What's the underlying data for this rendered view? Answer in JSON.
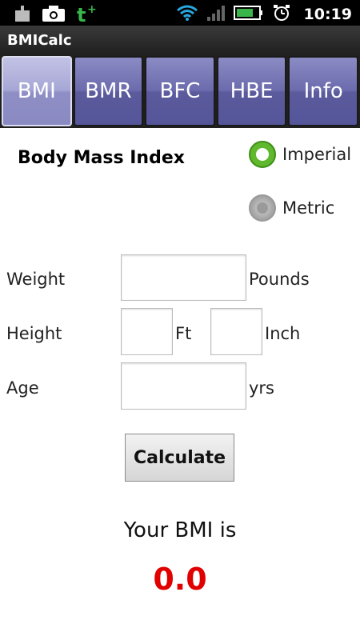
{
  "status_bar": {
    "time": "10:19",
    "icons": [
      "download-icon",
      "camera-icon",
      "t-plus-icon",
      "wifi-icon",
      "signal-icon",
      "battery-icon",
      "alarm-icon"
    ]
  },
  "app": {
    "title": "BMICalc"
  },
  "tabs": [
    {
      "label": "BMI",
      "active": true
    },
    {
      "label": "BMR",
      "active": false
    },
    {
      "label": "BFC",
      "active": false
    },
    {
      "label": "HBE",
      "active": false
    },
    {
      "label": "Info",
      "active": false
    }
  ],
  "form": {
    "heading": "Body Mass Index",
    "units": [
      {
        "label": "Imperial",
        "checked": true
      },
      {
        "label": "Metric",
        "checked": false
      }
    ],
    "weight": {
      "label": "Weight",
      "value": "",
      "unit": "Pounds"
    },
    "height": {
      "label": "Height",
      "ft_value": "",
      "ft_unit": "Ft",
      "inch_value": "",
      "inch_unit": "Inch"
    },
    "age": {
      "label": "Age",
      "value": "",
      "unit": "yrs"
    },
    "calculate_label": "Calculate"
  },
  "result": {
    "label": "Your BMI is",
    "value": "0.0",
    "value_color": "#e00000"
  },
  "colors": {
    "tab": "#6c6cae",
    "tab_active": "#a7a7d6",
    "radio_checked": "#5fb82e"
  }
}
